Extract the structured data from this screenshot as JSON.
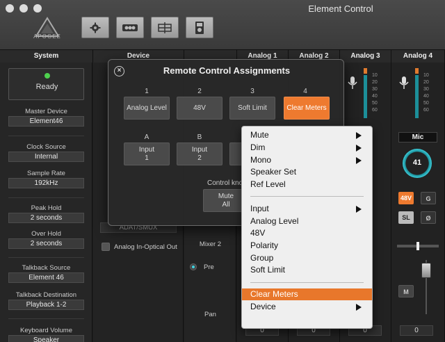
{
  "app": {
    "title": "Element Control",
    "logo_text": "APOGEE"
  },
  "toolbar": [
    {
      "name": "settings-button",
      "icon": "gear-icon"
    },
    {
      "name": "io-button",
      "icon": "io-icon"
    },
    {
      "name": "mixer-view-button",
      "icon": "grid-icon"
    },
    {
      "name": "device-button",
      "icon": "speaker-icon"
    }
  ],
  "columns": {
    "system": "System",
    "device": "Device",
    "analog1": "Analog 1",
    "analog2": "Analog 2",
    "analog3": "Analog 3",
    "analog4": "Analog 4"
  },
  "system": {
    "status": "Ready",
    "master_device_label": "Master Device",
    "master_device_value": "Element46",
    "clock_source_label": "Clock Source",
    "clock_source_value": "Internal",
    "sample_rate_label": "Sample Rate",
    "sample_rate_value": "192kHz",
    "peak_hold_label": "Peak Hold",
    "peak_hold_value": "2 seconds",
    "over_hold_label": "Over Hold",
    "over_hold_value": "2 seconds",
    "talkback_source_label": "Talkback Source",
    "talkback_source_value": "Element 46",
    "talkback_dest_label": "Talkback Destination",
    "talkback_dest_value": "Playback 1-2",
    "keyboard_volume_label": "Keyboard Volume",
    "keyboard_volume_value": "Speaker"
  },
  "device": {
    "optical_format": "ADAT/SMUX",
    "optical_out_label": "Analog In-Optical Out"
  },
  "mixer": {
    "mixer2_label": "Mixer 2",
    "pre_label": "Pre",
    "pan_label": "Pan"
  },
  "strips": {
    "mic_label": "Mic",
    "gain_value": "41",
    "phantom_label": "48V",
    "g_label": "G",
    "sl_label": "SL",
    "phase_label": "Ø",
    "mute_label": "M",
    "fader_value": "0",
    "scale": [
      "10",
      "20",
      "30",
      "40",
      "50",
      "60"
    ]
  },
  "modal": {
    "title": "Remote Control Assignments",
    "numbers": [
      "1",
      "2",
      "3",
      "4"
    ],
    "buttons": [
      "Analog Level",
      "48V",
      "Soft Limit",
      "Clear Meters"
    ],
    "letters": [
      "A",
      "B"
    ],
    "letter_buttons_l1": [
      "Input",
      "Input"
    ],
    "letter_buttons_l2": [
      "1",
      "2"
    ],
    "control_knob_label": "Control kno",
    "mute_all_l1": "Mute",
    "mute_all_l2": "All"
  },
  "menu": {
    "items": [
      {
        "label": "Mute",
        "submenu": true
      },
      {
        "label": "Dim",
        "submenu": true
      },
      {
        "label": "Mono",
        "submenu": true
      },
      {
        "label": "Speaker Set",
        "submenu": false
      },
      {
        "label": "Ref Level",
        "submenu": false
      },
      {
        "label": "Input",
        "submenu": true
      },
      {
        "label": "Analog Level",
        "submenu": false
      },
      {
        "label": "48V",
        "submenu": false
      },
      {
        "label": "Polarity",
        "submenu": false
      },
      {
        "label": "Group",
        "submenu": false
      },
      {
        "label": "Soft Limit",
        "submenu": false
      },
      {
        "label": "Clear Meters",
        "submenu": false,
        "highlighted": true
      },
      {
        "label": "Device",
        "submenu": true
      }
    ]
  },
  "colors": {
    "accent": "#ee7a2f",
    "meter": "#1c8f99",
    "ready": "#4ed14e"
  }
}
